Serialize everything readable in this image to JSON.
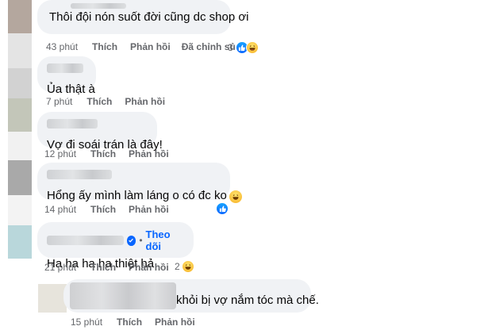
{
  "comments": [
    {
      "text": "Thôi đội nón suốt đời cũng dc shop ơi",
      "time": "43 phút",
      "like": "Thích",
      "reply": "Phản hồi",
      "edited": "Đã chỉnh sửa",
      "reaction_count": "3"
    },
    {
      "text": "Ủa thật à",
      "time": "7 phút",
      "like": "Thích",
      "reply": "Phản hồi"
    },
    {
      "text": "Vợ đi soái trán là đây!",
      "time": "12 phút",
      "like": "Thích",
      "reply": "Phản hồi"
    },
    {
      "text": "Hổng ấy mình làm láng o có đc ko",
      "time": "14 phút",
      "like": "Thích",
      "reply": "Phản hồi"
    },
    {
      "follow_label": "Theo dõi",
      "text": "Ha ha ha ha thiệt hả",
      "time": "21 phút",
      "like": "Thích",
      "reply": "Phản hồi",
      "reaction_count": "2"
    },
    {
      "text": "khỏi bị vợ nắm tóc mà chế.",
      "time": "15 phút",
      "like": "Thích",
      "reply": "Phản hồi"
    }
  ],
  "colors": {
    "bubble": "#f0f2f5",
    "meta_text": "#65676b",
    "link_blue": "#0866ff",
    "like_blue": "#0866ff",
    "haha_yellow": "#f7b125"
  },
  "icons": [
    "like-icon",
    "haha-icon",
    "verified-badge-icon"
  ]
}
